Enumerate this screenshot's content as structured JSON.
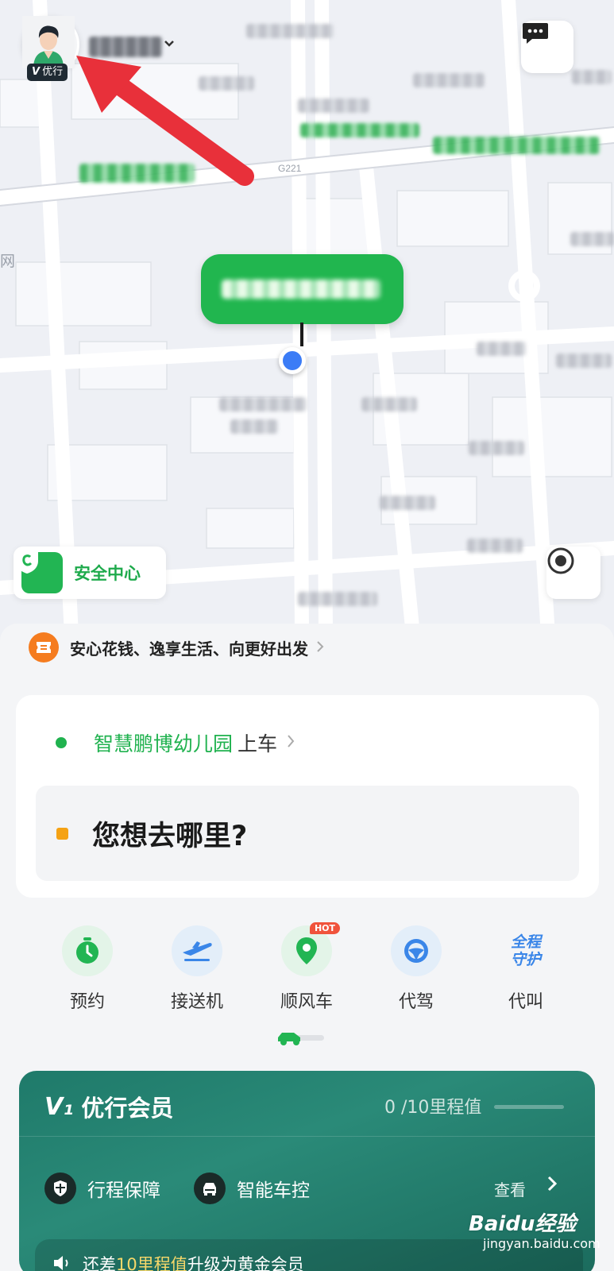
{
  "header": {
    "vip_badge_mark": "V",
    "vip_badge_label": "优行"
  },
  "map": {
    "edge_label": "网",
    "road_label": "G221"
  },
  "safety": {
    "label": "安全中心"
  },
  "promo": {
    "slogan": "安心花钱、逸享生活、向更好出发"
  },
  "route": {
    "pickup_place": "智慧鹏博幼儿园",
    "pickup_action": "上车",
    "destination_placeholder": "您想去哪里?"
  },
  "services": [
    {
      "label": "预约",
      "icon": "clock-icon"
    },
    {
      "label": "接送机",
      "icon": "airplane-icon"
    },
    {
      "label": "顺风车",
      "icon": "location-pin-icon",
      "badge": "HOT"
    },
    {
      "label": "代驾",
      "icon": "steering-wheel-icon"
    },
    {
      "label": "代叫",
      "icon_text_line1": "全程",
      "icon_text_line2": "守护"
    }
  ],
  "member": {
    "mark": "V₁",
    "title": "优行会员",
    "progress": "0 /10里程值",
    "benefits": [
      {
        "label": "行程保障",
        "icon": "shield-icon"
      },
      {
        "label": "智能车控",
        "icon": "car-icon"
      }
    ],
    "view_label": "查看",
    "upgrade_prefix": "还差",
    "upgrade_highlight": "10里程值",
    "upgrade_suffix": "升级为黄金会员"
  },
  "watermark": {
    "brand": "Baidu经验",
    "url": "jingyan.baidu.com"
  },
  "colors": {
    "brand_green": "#21b64f",
    "accent_orange": "#f57c1f",
    "member_teal": "#1f7a6a",
    "location_blue": "#3b7cf6",
    "annotation_red": "#e8303a"
  }
}
